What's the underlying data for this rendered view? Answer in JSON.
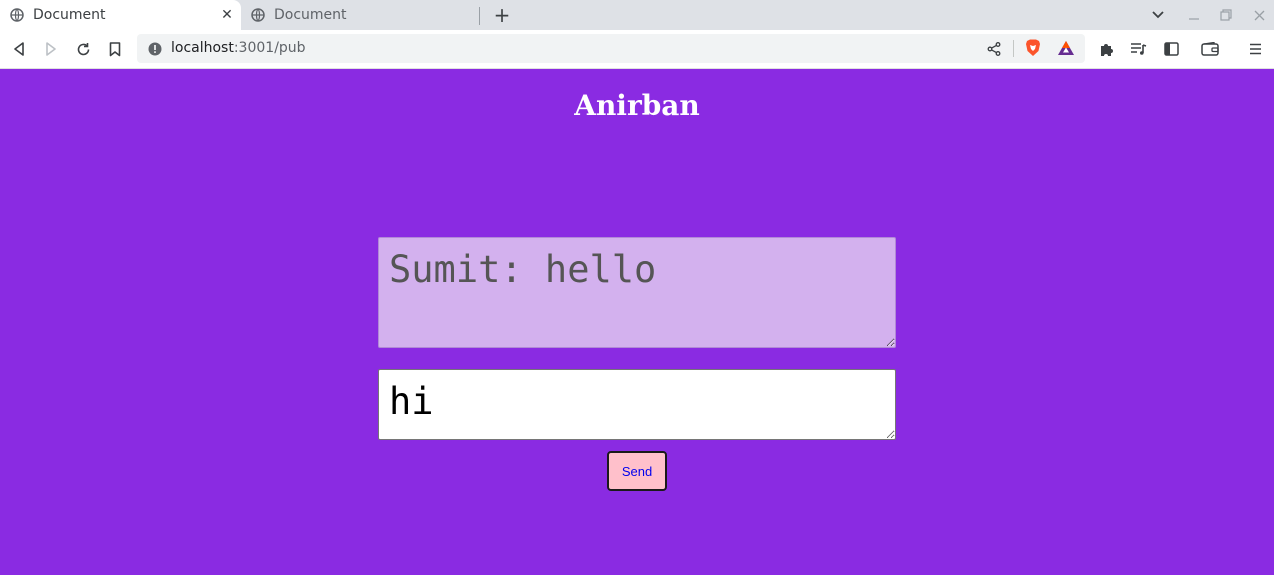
{
  "browser": {
    "tabs": [
      {
        "title": "Document",
        "active": true
      },
      {
        "title": "Document",
        "active": false
      }
    ],
    "address": {
      "host": "localhost",
      "path": ":3001/pub"
    },
    "icons": [
      "globe-icon",
      "close-icon",
      "new-tab-icon",
      "back-icon",
      "forward-icon",
      "reload-icon",
      "bookmark-icon",
      "info-icon",
      "share-icon",
      "brave-shields-icon",
      "brave-rewards-icon",
      "extensions-icon",
      "playlist-icon",
      "sidebar-icon",
      "wallet-icon",
      "menu-icon"
    ]
  },
  "page": {
    "background": "#8a2be2",
    "heading": "Anirban",
    "chat_log": "Sumit: hello",
    "message_value": "hi",
    "send_label": "Send"
  }
}
